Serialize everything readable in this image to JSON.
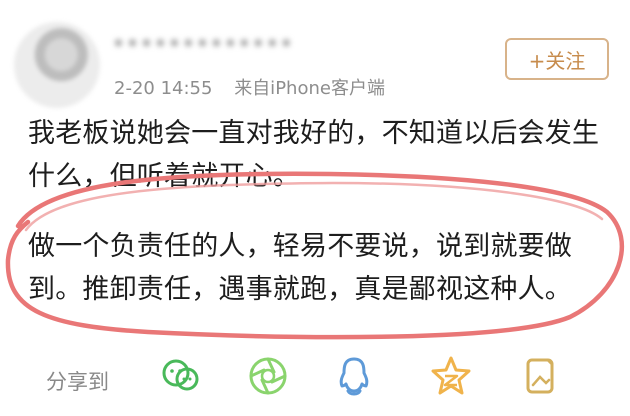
{
  "post": {
    "username": "•••••••••••••",
    "time": "2-20 14:55",
    "source": "来自iPhone客户端",
    "follow_label": "+关注",
    "paragraph_1": "我老板说她会一直对我好的，不知道以后会发生什么，但听着就开心。",
    "paragraph_2": "做一个负责任的人，轻易不要说，说到就要做到。推卸责任，遇事就跑，真是鄙视这种人。"
  },
  "share": {
    "label": "分享到",
    "targets": [
      "wechat-icon",
      "moments-icon",
      "qq-icon",
      "qzone-icon",
      "save-image-icon"
    ]
  },
  "colors": {
    "follow": "#c78c4d",
    "highlight": "#e97777",
    "text": "#1d1d1d",
    "muted": "#8d8d8d",
    "wechat": "#49b95a",
    "moments": "#8ad46d",
    "qq": "#5e9ad8",
    "qzone": "#f0b34b",
    "save": "#d4b05e"
  }
}
